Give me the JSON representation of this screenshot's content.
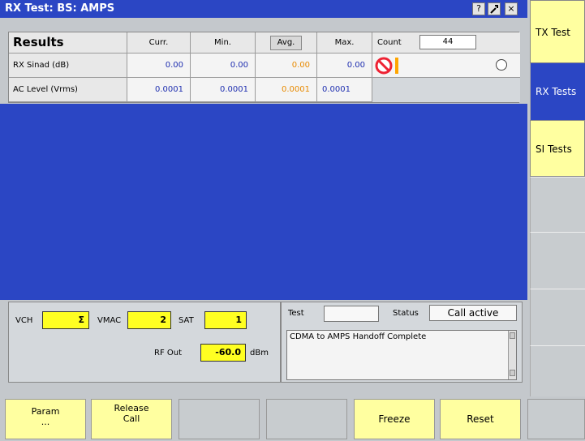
{
  "window": {
    "title": "RX Test: BS: AMPS",
    "help_glyph": "?",
    "close_glyph": "×"
  },
  "results": {
    "title": "Results",
    "headers": {
      "curr": "Curr.",
      "min": "Min.",
      "avg": "Avg.",
      "max": "Max.",
      "count_label": "Count",
      "count_value": "44"
    },
    "rows": [
      {
        "label": "RX Sinad (dB)",
        "curr": "0.00",
        "min": "0.00",
        "avg": "0.00",
        "max": "0.00"
      },
      {
        "label": "AC Level (Vrms)",
        "curr": "0.0001",
        "min": "0.0001",
        "avg": "0.0001",
        "max": "0.0001"
      }
    ]
  },
  "status_panel": {
    "vch_label": "VCH",
    "vch_value": "Σ",
    "vmac_label": "VMAC",
    "vmac_value": "2",
    "sat_label": "SAT",
    "sat_value": "1",
    "rfout_label": "RF Out",
    "rfout_value": "-60.0",
    "rfout_unit": "dBm",
    "test_label": "Test",
    "test_value": "",
    "status_label": "Status",
    "status_value": "Call active",
    "message": "CDMA to AMPS Handoff Complete"
  },
  "side_menu": {
    "items": [
      "TX Test",
      "RX Tests",
      "SI Tests",
      "",
      "",
      "",
      ""
    ]
  },
  "softkeys": {
    "param_line1": "Param",
    "param_line2": "...",
    "release_line1": "Release",
    "release_line2": "Call",
    "freeze": "Freeze",
    "reset": "Reset"
  },
  "colors": {
    "accent_blue": "#2b46c4",
    "yellow_field": "#ffff22",
    "avg_orange": "#e88a00"
  }
}
